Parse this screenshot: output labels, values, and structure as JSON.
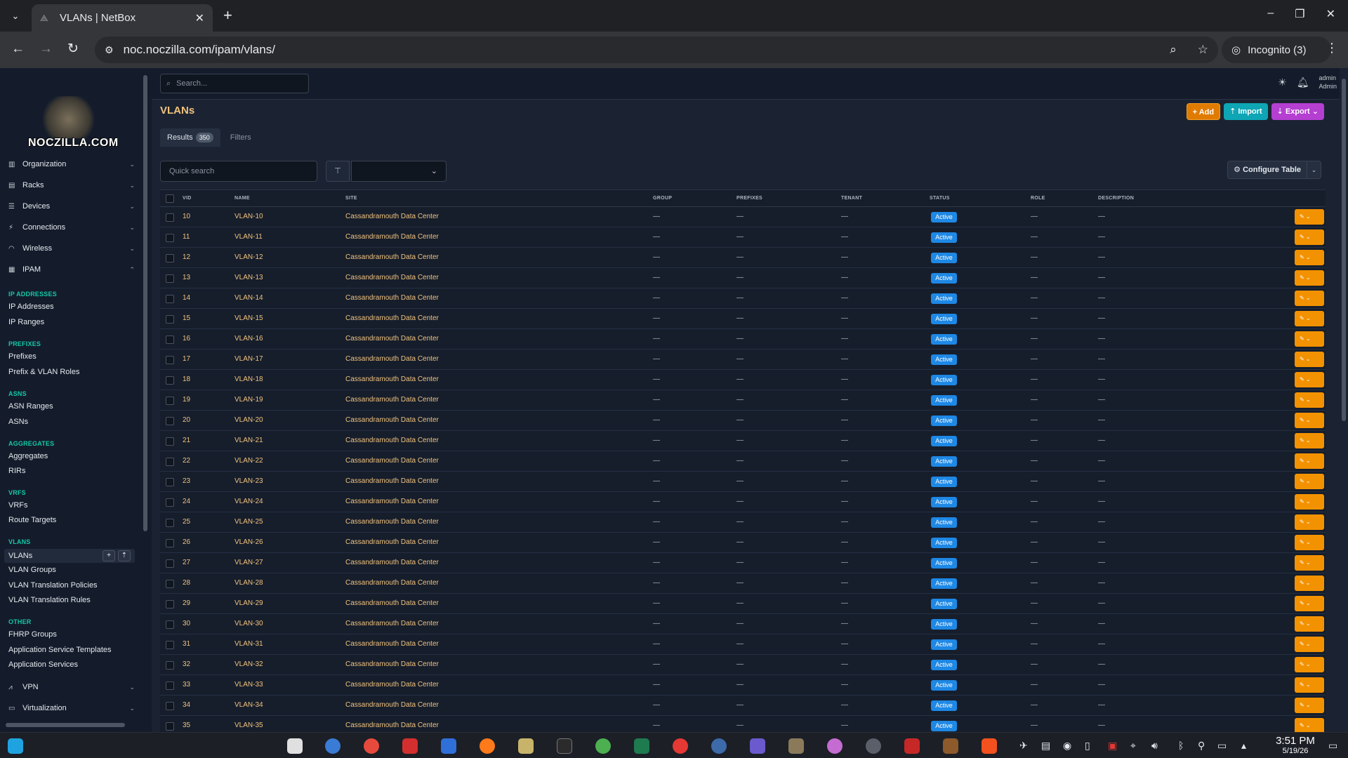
{
  "browser": {
    "tab_title": "VLANs | NetBox",
    "url": "noc.noczilla.com/ipam/vlans/",
    "incognito_label": "Incognito (3)"
  },
  "sidebar": {
    "logo_text": "NOCZILLA.COM",
    "menus": [
      {
        "label": "Organization",
        "icon": "building-icon"
      },
      {
        "label": "Racks",
        "icon": "rack-icon"
      },
      {
        "label": "Devices",
        "icon": "server-icon"
      },
      {
        "label": "Connections",
        "icon": "cable-icon"
      },
      {
        "label": "Wireless",
        "icon": "wifi-icon"
      },
      {
        "label": "IPAM",
        "icon": "counter-icon"
      }
    ],
    "sections": [
      {
        "heading": "IP ADDRESSES",
        "links": [
          "IP Addresses",
          "IP Ranges"
        ]
      },
      {
        "heading": "PREFIXES",
        "links": [
          "Prefixes",
          "Prefix & VLAN Roles"
        ]
      },
      {
        "heading": "ASNS",
        "links": [
          "ASN Ranges",
          "ASNs"
        ]
      },
      {
        "heading": "AGGREGATES",
        "links": [
          "Aggregates",
          "RIRs"
        ]
      },
      {
        "heading": "VRFS",
        "links": [
          "VRFs",
          "Route Targets"
        ]
      },
      {
        "heading": "VLANS",
        "links": [
          "VLANs",
          "VLAN Groups",
          "VLAN Translation Policies",
          "VLAN Translation Rules"
        ]
      },
      {
        "heading": "OTHER",
        "links": [
          "FHRP Groups",
          "Application Service Templates",
          "Application Services"
        ]
      }
    ],
    "bottom_menus": [
      {
        "label": "VPN",
        "icon": "vpn-icon"
      },
      {
        "label": "Virtualization",
        "icon": "monitor-icon"
      }
    ]
  },
  "topbar": {
    "search_placeholder": "Search...",
    "user_name": "admin",
    "user_role": "Admin"
  },
  "page": {
    "title": "VLANs",
    "add_label": "Add",
    "import_label": "Import",
    "export_label": "Export",
    "tab_results": "Results",
    "results_count": "350",
    "tab_filters": "Filters",
    "quick_search_placeholder": "Quick search",
    "configure_table_label": "Configure Table"
  },
  "table": {
    "columns": [
      "VID",
      "NAME",
      "SITE",
      "GROUP",
      "PREFIXES",
      "TENANT",
      "STATUS",
      "ROLE",
      "DESCRIPTION"
    ],
    "site": "Cassandramouth Data Center",
    "status": "Active",
    "empty": "—",
    "vids": [
      "10",
      "11",
      "12",
      "13",
      "14",
      "15",
      "16",
      "17",
      "18",
      "19",
      "20",
      "21",
      "22",
      "23",
      "24",
      "25",
      "26",
      "27",
      "28",
      "29",
      "30",
      "31",
      "32",
      "33",
      "34",
      "35"
    ],
    "names": [
      "VLAN-10",
      "VLAN-11",
      "VLAN-12",
      "VLAN-13",
      "VLAN-14",
      "VLAN-15",
      "VLAN-16",
      "VLAN-17",
      "VLAN-18",
      "VLAN-19",
      "VLAN-20",
      "VLAN-21",
      "VLAN-22",
      "VLAN-23",
      "VLAN-24",
      "VLAN-25",
      "VLAN-26",
      "VLAN-27",
      "VLAN-28",
      "VLAN-29",
      "VLAN-30",
      "VLAN-31",
      "VLAN-32",
      "VLAN-33",
      "VLAN-34",
      "VLAN-35"
    ]
  },
  "taskbar": {
    "time": "3:51 PM",
    "date": "5/19/26"
  },
  "colors": {
    "accent_orange": "#f39200",
    "status_active": "#1e88e5",
    "section_teal": "#14c8a8",
    "link_gold": "#f1c27d"
  }
}
